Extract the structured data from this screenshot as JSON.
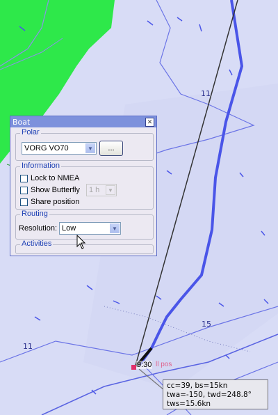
{
  "map": {
    "depth_labels": [
      "11",
      "15",
      "11"
    ],
    "time_label": "9:30",
    "position_label": "ll pos",
    "colors": {
      "sea": "#d8dcf6",
      "land": "#2ee84a",
      "route": "#4a55e8",
      "contour": "#6b74e6"
    }
  },
  "dialog": {
    "title": "Boat",
    "close_icon": "close-icon",
    "polar": {
      "legend": "Polar",
      "selected": "VORG VO70",
      "browse_label": "..."
    },
    "information": {
      "legend": "Information",
      "lock_nmea": "Lock to NMEA",
      "show_butterfly": "Show Butterfly",
      "butterfly_value": "1 h",
      "share_position": "Share position"
    },
    "routing": {
      "legend": "Routing",
      "resolution_label": "Resolution:",
      "resolution_value": "Low"
    },
    "activities": {
      "legend": "Activities"
    }
  },
  "tooltip": {
    "line1": "cc=39,  bs=15kn",
    "line2": "twa=-150, twd=248.8°",
    "line3": "tws=15.6kn"
  }
}
